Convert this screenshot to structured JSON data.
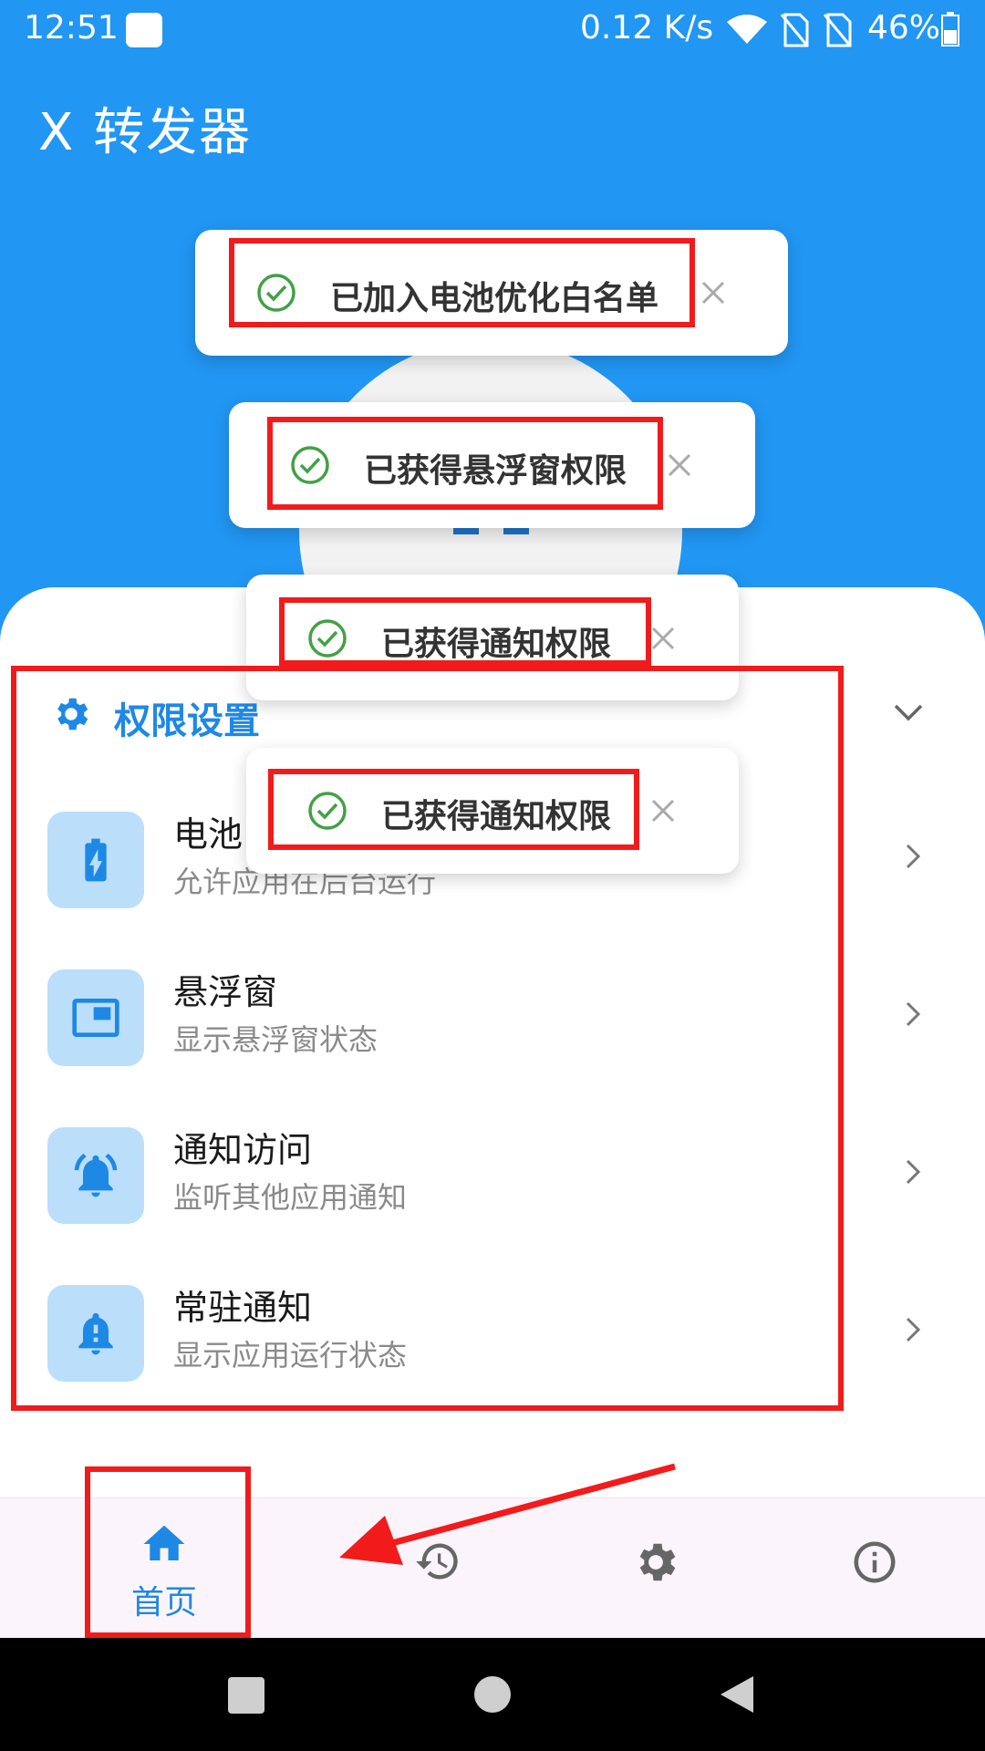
{
  "status_bar": {
    "time": "12:51",
    "network_speed": "0.12 K/s",
    "battery_percent": "46%",
    "icons": [
      "app-notification-icon",
      "wifi-icon",
      "no-sim-icon",
      "no-sim-icon",
      "battery-icon"
    ]
  },
  "app": {
    "title": "X 转发器"
  },
  "toasts": [
    {
      "label": "已加入电池优化白名单",
      "icon": "check-circle-icon"
    },
    {
      "label": "已获得悬浮窗权限",
      "icon": "check-circle-icon"
    },
    {
      "label": "已获得通知权限",
      "icon": "check-circle-icon"
    },
    {
      "label": "已获得通知权限",
      "icon": "check-circle-icon"
    }
  ],
  "permissions": {
    "section_title": "权限设置",
    "items": [
      {
        "title": "电池",
        "subtitle": "允许应用在后台运行",
        "icon": "battery-charging-icon"
      },
      {
        "title": "悬浮窗",
        "subtitle": "显示悬浮窗状态",
        "icon": "picture-in-picture-icon"
      },
      {
        "title": "通知访问",
        "subtitle": "监听其他应用通知",
        "icon": "notification-ringing-icon"
      },
      {
        "title": "常驻通知",
        "subtitle": "显示应用运行状态",
        "icon": "notification-important-icon"
      }
    ]
  },
  "bottom_nav": {
    "home_label": "首页",
    "items": [
      "home-icon",
      "history-icon",
      "settings-icon",
      "info-icon"
    ]
  },
  "colors": {
    "header_blue": "#2196F3",
    "accent_blue": "#1E88E5",
    "icon_bg": "#BBDEFB",
    "success_green": "#43A047",
    "annotation_red": "#F21B1B"
  }
}
